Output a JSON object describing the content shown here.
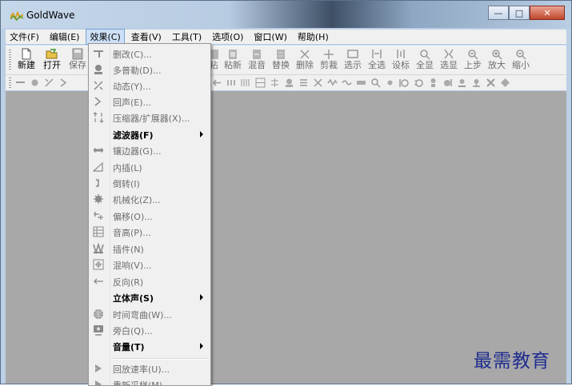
{
  "window": {
    "title": "GoldWave",
    "minimize": "—",
    "maximize": "□",
    "close": "✕"
  },
  "menubar": [
    {
      "label": "文件(F)"
    },
    {
      "label": "编辑(E)"
    },
    {
      "label": "效果(C)"
    },
    {
      "label": "查看(V)"
    },
    {
      "label": "工具(T)"
    },
    {
      "label": "选项(O)"
    },
    {
      "label": "窗口(W)"
    },
    {
      "label": "帮助(H)"
    }
  ],
  "toolbar": {
    "left": [
      {
        "label": "新建",
        "icon": "new-file-icon"
      },
      {
        "label": "打开",
        "icon": "open-folder-icon"
      },
      {
        "label": "保存",
        "icon": "save-icon"
      }
    ],
    "right": [
      {
        "label": "粘",
        "icon": "paste-icon"
      },
      {
        "label": "粘新",
        "icon": "paste-new-icon"
      },
      {
        "label": "混音",
        "icon": "mix-icon"
      },
      {
        "label": "替换",
        "icon": "replace-icon"
      },
      {
        "label": "删除",
        "icon": "delete-icon"
      },
      {
        "label": "剪裁",
        "icon": "trim-icon"
      },
      {
        "label": "选示",
        "icon": "show-selection-icon"
      },
      {
        "label": "全选",
        "icon": "select-all-icon"
      },
      {
        "label": "设标",
        "icon": "set-marker-icon"
      },
      {
        "label": "全显",
        "icon": "show-all-icon"
      },
      {
        "label": "选显",
        "icon": "show-selected-icon"
      },
      {
        "label": "上步",
        "icon": "previous-icon"
      },
      {
        "label": "放大",
        "icon": "zoom-in-icon"
      },
      {
        "label": "缩小",
        "icon": "zoom-out-icon"
      }
    ]
  },
  "effects_menu": {
    "items": [
      {
        "label": "删改(C)...",
        "icon": "alter-icon",
        "enabled": false
      },
      {
        "label": "多普勒(D)...",
        "icon": "doppler-icon",
        "enabled": false
      },
      {
        "label": "动态(Y)...",
        "icon": "dynamics-icon",
        "enabled": false
      },
      {
        "label": "回声(E)...",
        "icon": "echo-icon",
        "enabled": false
      },
      {
        "label": "压缩器/扩展器(X)...",
        "icon": "compressor-icon",
        "enabled": false
      },
      {
        "label": "滤波器(F)",
        "icon": "",
        "enabled": true,
        "submenu": true
      },
      {
        "label": "镶边器(G)...",
        "icon": "flanger-icon",
        "enabled": false
      },
      {
        "label": "内插(L)",
        "icon": "interpolate-icon",
        "enabled": false
      },
      {
        "label": "倒转(I)",
        "icon": "invert-icon",
        "enabled": false
      },
      {
        "label": "机械化(Z)...",
        "icon": "mechanize-icon",
        "enabled": false
      },
      {
        "label": "偏移(O)...",
        "icon": "offset-icon",
        "enabled": false
      },
      {
        "label": "音高(P)...",
        "icon": "pitch-icon",
        "enabled": false
      },
      {
        "label": "插件(N)",
        "icon": "plugin-icon",
        "enabled": false
      },
      {
        "label": "混响(V)...",
        "icon": "reverb-icon",
        "enabled": false
      },
      {
        "label": "反向(R)",
        "icon": "reverse-icon",
        "enabled": false
      },
      {
        "label": "立体声(S)",
        "icon": "",
        "enabled": true,
        "submenu": true
      },
      {
        "label": "时间弯曲(W)...",
        "icon": "time-warp-icon",
        "enabled": false
      },
      {
        "label": "旁白(Q)...",
        "icon": "voice-over-icon",
        "enabled": false
      },
      {
        "label": "音量(T)",
        "icon": "",
        "enabled": true,
        "submenu": true
      },
      {
        "label": "回放速率(U)...",
        "icon": "playback-rate-icon",
        "enabled": false
      },
      {
        "label": "重新采样(M)...",
        "icon": "resample-icon",
        "enabled": false
      }
    ]
  },
  "watermark": "最需教育"
}
